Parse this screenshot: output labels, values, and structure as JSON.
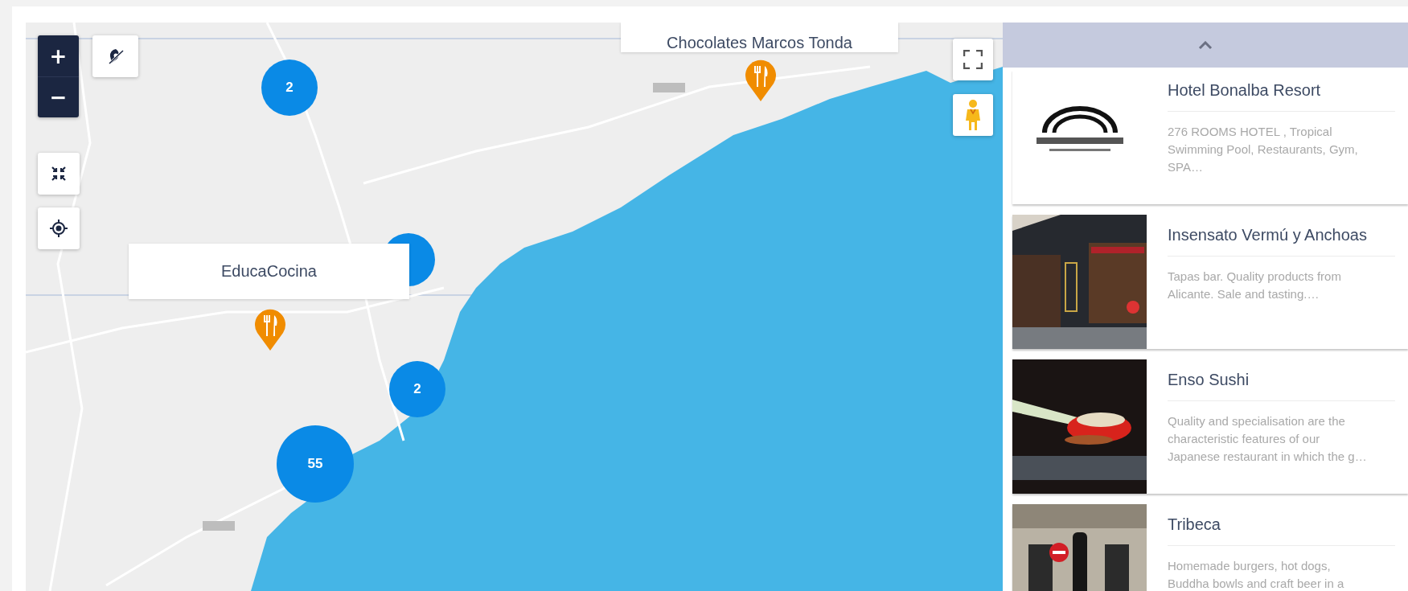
{
  "map": {
    "zoom": {
      "in": "+",
      "out": "−"
    },
    "clusters": [
      {
        "kind": "counted",
        "count": "2"
      },
      {
        "kind": "covered"
      },
      {
        "kind": "counted",
        "count": "2"
      },
      {
        "kind": "counted",
        "count": "55"
      }
    ],
    "popups": [
      {
        "title": "EducaCocina"
      },
      {
        "title": "Chocolates Marcos Tonda"
      }
    ]
  },
  "places": [
    {
      "title": "Hotel Bonalba Resort",
      "description": "276 ROOMS HOTEL , Tropical Swimming Pool, Restaurants, Gym, SPA…"
    },
    {
      "title": "Insensato Vermú y Anchoas",
      "description": "Tapas bar. Quality products from Alicante. Sale and tasting.…"
    },
    {
      "title": "Enso Sushi",
      "description": "Quality and specialisation are the characteristic features of our Japanese restaurant in which the g…"
    },
    {
      "title": "Tribeca",
      "description": "Homemade burgers, hot dogs, Buddha bowls and craft beer in a"
    }
  ]
}
